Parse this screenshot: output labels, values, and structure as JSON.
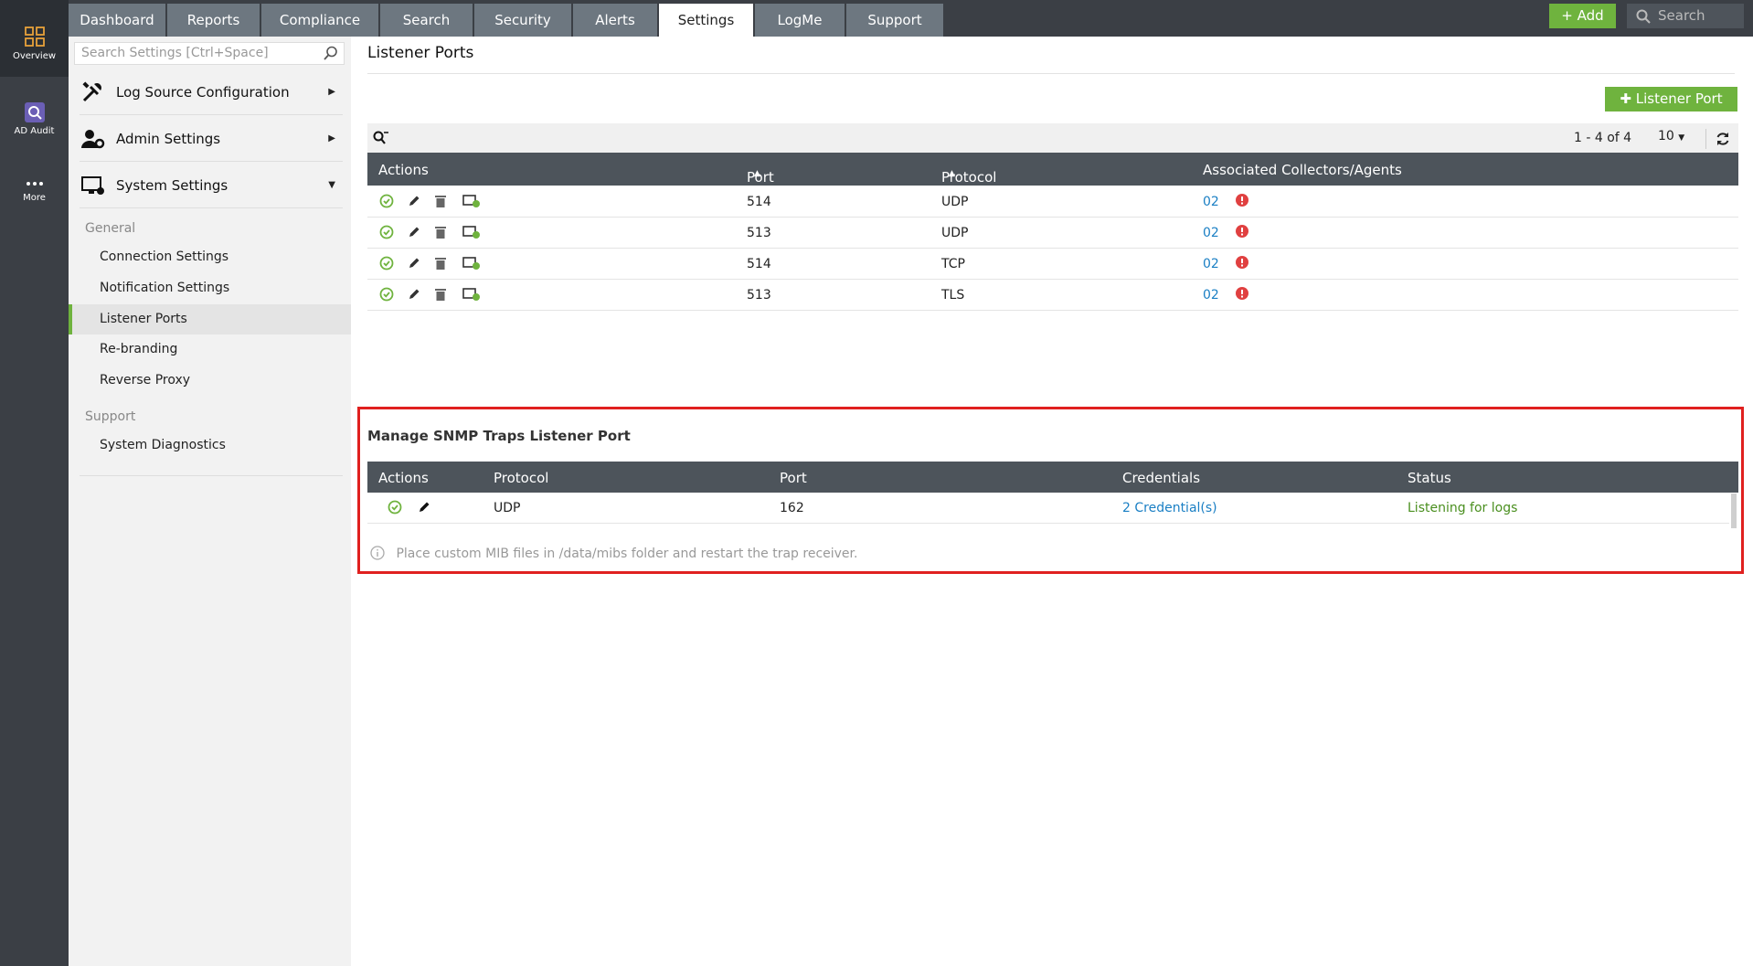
{
  "rail": {
    "items": [
      {
        "label": "Overview",
        "icon": "grid-icon"
      },
      {
        "label": "AD Audit",
        "icon": "ad-audit-icon"
      },
      {
        "label": "More",
        "icon": "more-dots-icon"
      }
    ]
  },
  "topnav": {
    "tabs": [
      "Dashboard",
      "Reports",
      "Compliance",
      "Search",
      "Security",
      "Alerts",
      "Settings",
      "LogMe",
      "Support"
    ],
    "active_tab": "Settings",
    "add_label": "Add",
    "search_placeholder": "Search"
  },
  "sidebar": {
    "search_placeholder": "Search Settings [Ctrl+Space]",
    "categories": [
      {
        "label": "Log Source Configuration",
        "icon": "tools-icon"
      },
      {
        "label": "Admin Settings",
        "icon": "admin-user-gear-icon"
      },
      {
        "label": "System Settings",
        "icon": "monitor-gear-icon"
      }
    ],
    "general_label": "General",
    "general_items": [
      "Connection Settings",
      "Notification Settings",
      "Listener Ports",
      "Re-branding",
      "Reverse Proxy"
    ],
    "support_label": "Support",
    "support_items": [
      "System Diagnostics"
    ]
  },
  "main": {
    "title": "Listener Ports",
    "add_listener_label": "Listener Port",
    "pager": "1 - 4 of 4",
    "per_page": "10",
    "columns": {
      "actions": "Actions",
      "port": "Port",
      "protocol": "Protocol",
      "collectors": "Associated Collectors/Agents"
    },
    "rows": [
      {
        "port": "514",
        "protocol": "UDP",
        "collectors": "02"
      },
      {
        "port": "513",
        "protocol": "UDP",
        "collectors": "02"
      },
      {
        "port": "514",
        "protocol": "TCP",
        "collectors": "02"
      },
      {
        "port": "513",
        "protocol": "TLS",
        "collectors": "02"
      }
    ]
  },
  "snmp": {
    "title": "Manage SNMP Traps Listener Port",
    "columns": {
      "actions": "Actions",
      "protocol": "Protocol",
      "port": "Port",
      "credentials": "Credentials",
      "status": "Status"
    },
    "row": {
      "protocol": "UDP",
      "port": "162",
      "credentials": "2 Credential(s)",
      "status": "Listening for logs"
    },
    "note": "Place custom MIB files in /data/mibs folder and restart the trap receiver."
  },
  "colors": {
    "accent_green": "#6fb33e",
    "header_dark": "#4d545b",
    "link_blue": "#1a7fc4",
    "highlight_red": "#e0201f",
    "error_red": "#e04040"
  }
}
